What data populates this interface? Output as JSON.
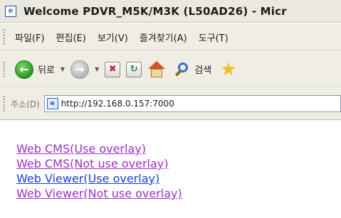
{
  "window": {
    "title": "Welcome PDVR_M5K/M3K (L50AD26) - Micr"
  },
  "menu": {
    "items": [
      "파일(F)",
      "편집(E)",
      "보기(V)",
      "즐겨찾기(A)",
      "도구(T)"
    ]
  },
  "toolbar": {
    "back_label": "뒤로",
    "search_label": "검색"
  },
  "address": {
    "label": "주소(D)",
    "value": "http://192.168.0.157:7000"
  },
  "content": {
    "links": [
      {
        "label": "Web CMS(Use overlay)",
        "color": "#9b2fc4"
      },
      {
        "label": "Web CMS(Not use overlay)",
        "color": "#9b2fc4"
      },
      {
        "label": "Web Viewer(Use overlay)",
        "color": "#1a3fd6"
      },
      {
        "label": "Web Viewer(Not use overlay)",
        "color": "#9b2fc4"
      }
    ]
  },
  "icons": {
    "title": "ie-page-icon",
    "back": "back-arrow-icon",
    "forward": "forward-arrow-icon",
    "stop": "stop-icon",
    "refresh": "refresh-icon",
    "home": "home-icon",
    "search": "search-icon",
    "favorites": "star-icon",
    "address_page": "page-icon"
  }
}
